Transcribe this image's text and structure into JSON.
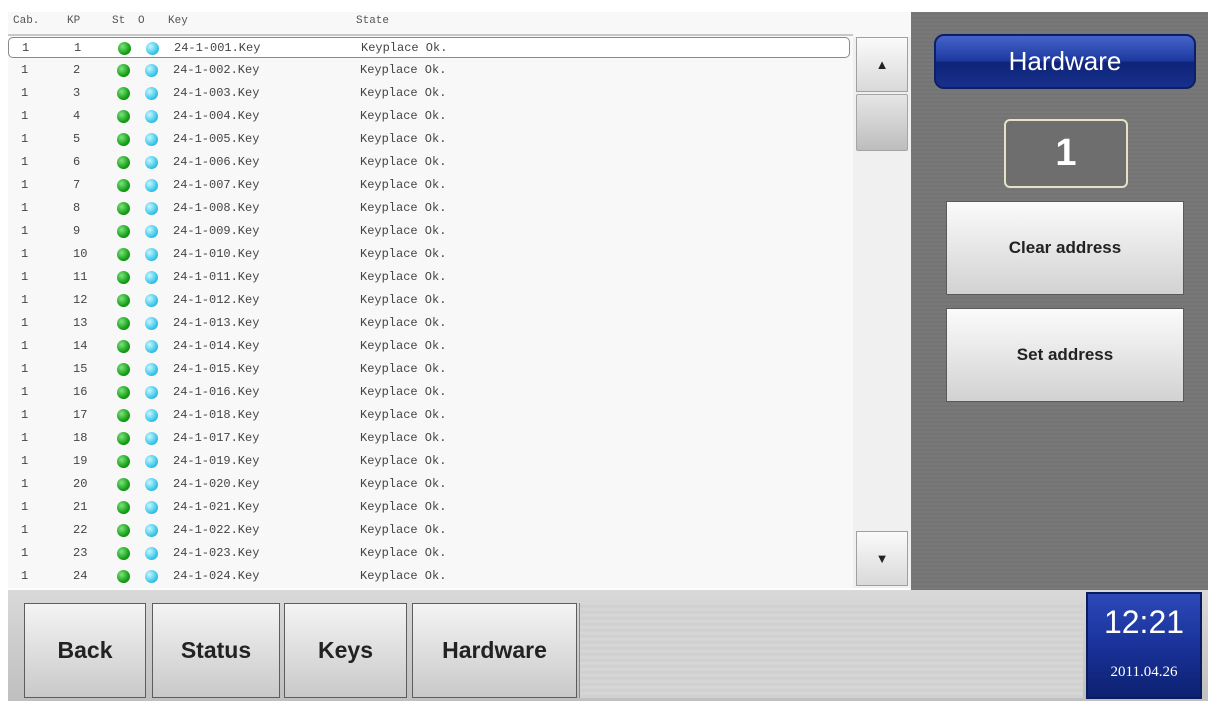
{
  "list": {
    "headers": {
      "cab": "Cab.",
      "kp": "KP",
      "st": "St",
      "o": "O",
      "key": "Key",
      "state": "State"
    },
    "rows": [
      {
        "cab": "1",
        "kp": "1",
        "key": "24-1-001.Key",
        "state": "Keyplace Ok.",
        "selected": true
      },
      {
        "cab": "1",
        "kp": "2",
        "key": "24-1-002.Key",
        "state": "Keyplace Ok."
      },
      {
        "cab": "1",
        "kp": "3",
        "key": "24-1-003.Key",
        "state": "Keyplace Ok."
      },
      {
        "cab": "1",
        "kp": "4",
        "key": "24-1-004.Key",
        "state": "Keyplace Ok."
      },
      {
        "cab": "1",
        "kp": "5",
        "key": "24-1-005.Key",
        "state": "Keyplace Ok."
      },
      {
        "cab": "1",
        "kp": "6",
        "key": "24-1-006.Key",
        "state": "Keyplace Ok."
      },
      {
        "cab": "1",
        "kp": "7",
        "key": "24-1-007.Key",
        "state": "Keyplace Ok."
      },
      {
        "cab": "1",
        "kp": "8",
        "key": "24-1-008.Key",
        "state": "Keyplace Ok."
      },
      {
        "cab": "1",
        "kp": "9",
        "key": "24-1-009.Key",
        "state": "Keyplace Ok."
      },
      {
        "cab": "1",
        "kp": "10",
        "key": "24-1-010.Key",
        "state": "Keyplace Ok."
      },
      {
        "cab": "1",
        "kp": "11",
        "key": "24-1-011.Key",
        "state": "Keyplace Ok."
      },
      {
        "cab": "1",
        "kp": "12",
        "key": "24-1-012.Key",
        "state": "Keyplace Ok."
      },
      {
        "cab": "1",
        "kp": "13",
        "key": "24-1-013.Key",
        "state": "Keyplace Ok."
      },
      {
        "cab": "1",
        "kp": "14",
        "key": "24-1-014.Key",
        "state": "Keyplace Ok."
      },
      {
        "cab": "1",
        "kp": "15",
        "key": "24-1-015.Key",
        "state": "Keyplace Ok."
      },
      {
        "cab": "1",
        "kp": "16",
        "key": "24-1-016.Key",
        "state": "Keyplace Ok."
      },
      {
        "cab": "1",
        "kp": "17",
        "key": "24-1-018.Key",
        "state": "Keyplace Ok."
      },
      {
        "cab": "1",
        "kp": "18",
        "key": "24-1-017.Key",
        "state": "Keyplace Ok."
      },
      {
        "cab": "1",
        "kp": "19",
        "key": "24-1-019.Key",
        "state": "Keyplace Ok."
      },
      {
        "cab": "1",
        "kp": "20",
        "key": "24-1-020.Key",
        "state": "Keyplace Ok."
      },
      {
        "cab": "1",
        "kp": "21",
        "key": "24-1-021.Key",
        "state": "Keyplace Ok."
      },
      {
        "cab": "1",
        "kp": "22",
        "key": "24-1-022.Key",
        "state": "Keyplace Ok."
      },
      {
        "cab": "1",
        "kp": "23",
        "key": "24-1-023.Key",
        "state": "Keyplace Ok."
      },
      {
        "cab": "1",
        "kp": "24",
        "key": "24-1-024.Key",
        "state": "Keyplace Ok."
      }
    ],
    "status_colors": {
      "st": "#17a017",
      "o": "#3cc8ea"
    }
  },
  "scrollbar": {
    "up_icon": "▲",
    "down_icon": "▼"
  },
  "side": {
    "title": "Hardware",
    "address_value": "1",
    "clear_label": "Clear address",
    "set_label": "Set address"
  },
  "nav": {
    "back": "Back",
    "status": "Status",
    "keys": "Keys",
    "hardware": "Hardware"
  },
  "clock": {
    "time": "12:21",
    "date": "2011.04.26"
  },
  "colors": {
    "title_blue": "#1e3aa0",
    "panel_gray": "#767676"
  }
}
